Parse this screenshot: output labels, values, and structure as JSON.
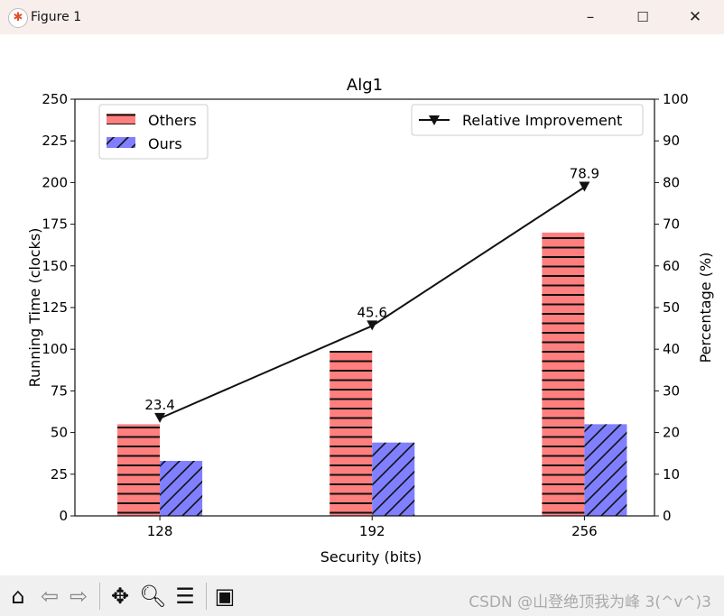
{
  "window": {
    "title": "Figure 1",
    "minimize": "–",
    "maximize": "☐",
    "close": "✕"
  },
  "toolbar": {
    "home": "home-icon",
    "back": "back-arrow-icon",
    "forward": "forward-arrow-icon",
    "pan": "pan-icon",
    "zoom": "zoom-icon",
    "configure": "configure-subplots-icon",
    "save": "save-icon"
  },
  "watermark": "CSDN @山登绝顶我为峰 3(^v^)3",
  "colors": {
    "others": "#ff7f7f",
    "ours": "#7f7fff",
    "line": "#111111"
  },
  "chart_data": {
    "type": "bar",
    "title": "Alg1",
    "xlabel": "Security (bits)",
    "ylabel": "Running Time (clocks)",
    "y2label": "Percentage (%)",
    "categories": [
      "128",
      "192",
      "256"
    ],
    "ylim": [
      0,
      250
    ],
    "yticks": [
      0,
      25,
      50,
      75,
      100,
      125,
      150,
      175,
      200,
      225,
      250
    ],
    "y2lim": [
      0,
      100
    ],
    "y2ticks": [
      0,
      10,
      20,
      30,
      40,
      50,
      60,
      70,
      80,
      90,
      100
    ],
    "series": [
      {
        "name": "Others",
        "values": [
          55,
          99,
          170
        ],
        "hatch": "horizontal",
        "color": "#ff7f7f"
      },
      {
        "name": "Ours",
        "values": [
          33,
          44,
          55
        ],
        "hatch": "diagonal",
        "color": "#7f7fff"
      }
    ],
    "line": {
      "name": "Relative Improvement",
      "values": [
        23.4,
        45.6,
        78.9
      ],
      "labels": [
        "23.4",
        "45.6",
        "78.9"
      ],
      "marker": "triangle-down",
      "axis": "right"
    },
    "legend": [
      "top-left",
      "top-right"
    ],
    "grid": false
  }
}
